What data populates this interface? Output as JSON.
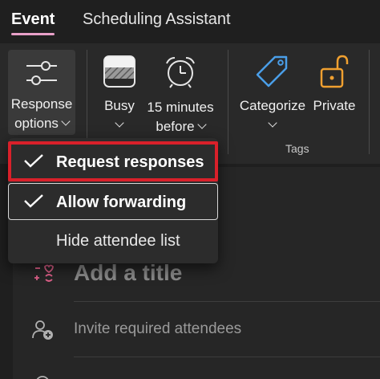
{
  "tabs": [
    {
      "label": "Event",
      "active": true
    },
    {
      "label": "Scheduling Assistant",
      "active": false
    }
  ],
  "ribbon": {
    "response_options": {
      "line1": "Response",
      "line2": "options",
      "icon": "sliders-icon"
    },
    "busy": {
      "label": "Busy",
      "icon": "status-busy-icon"
    },
    "reminder": {
      "line1": "15 minutes",
      "line2": "before",
      "icon": "alarm-clock-icon"
    },
    "categorize": {
      "label": "Categorize",
      "icon": "tag-icon"
    },
    "private": {
      "label": "Private",
      "icon": "unlocked-padlock-icon"
    },
    "tags_group_label": "Tags"
  },
  "menu": {
    "items": [
      {
        "label": "Request responses",
        "checked": true
      },
      {
        "label": "Allow forwarding",
        "checked": true
      },
      {
        "label": "Hide attendee list",
        "checked": false
      }
    ]
  },
  "form": {
    "title_placeholder": "Add a title",
    "attendees_placeholder": "Invite required attendees"
  },
  "colors": {
    "accent_tab": "#e8a0c8",
    "highlight_red": "#d9202a",
    "categorize_icon": "#4a9ee8",
    "private_icon": "#f0a030",
    "title_icon": "#e0608a"
  }
}
